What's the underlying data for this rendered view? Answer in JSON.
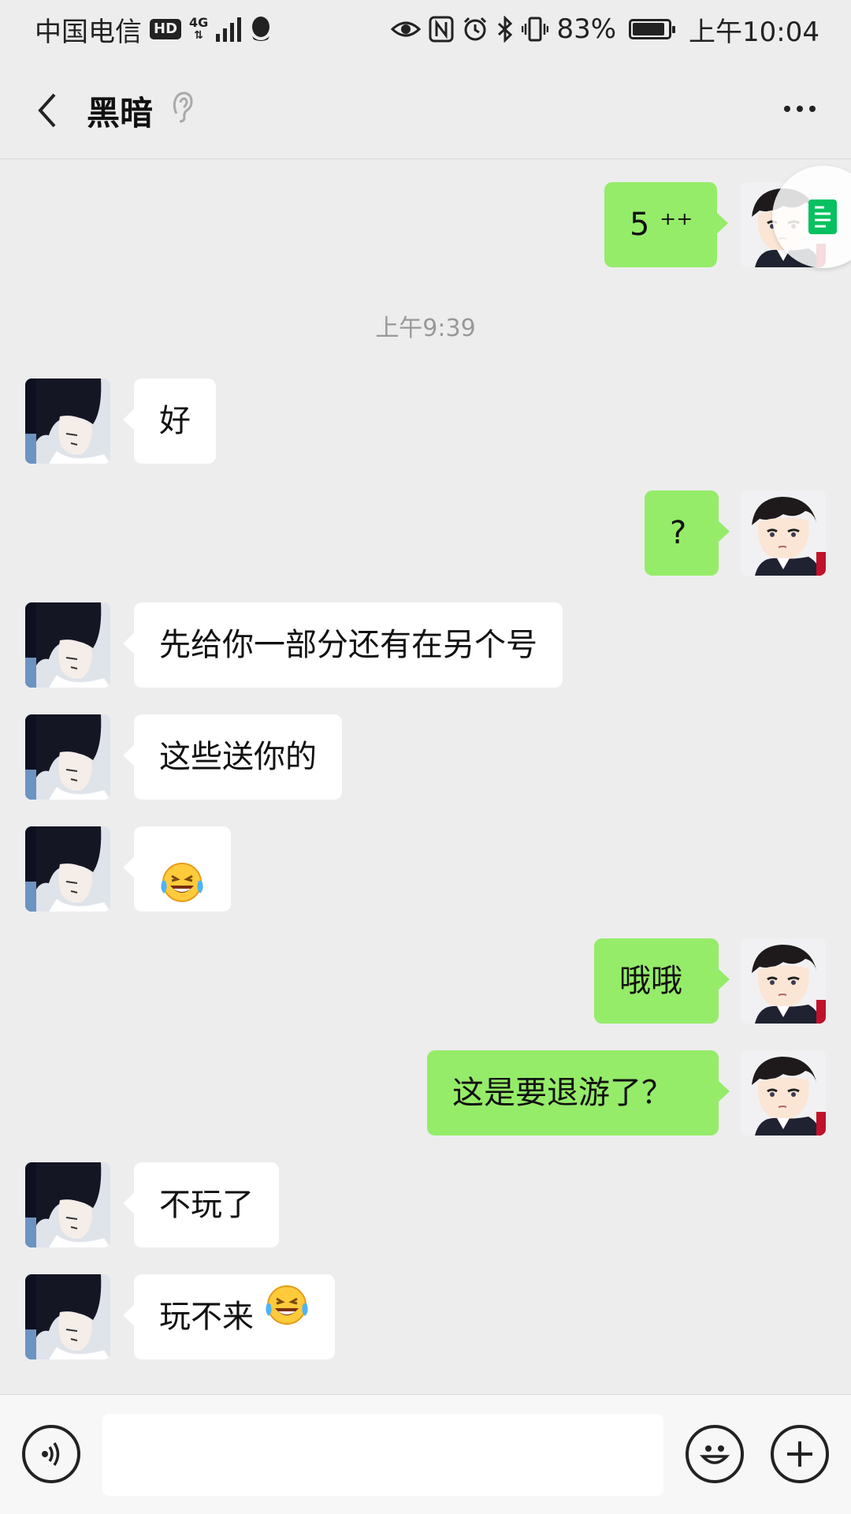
{
  "status_bar": {
    "carrier": "中国电信",
    "hd": "HD",
    "network_top": "4G",
    "network_bottom": "⇅",
    "battery_percent": "83%",
    "battery_level": 0.83,
    "time": "上午10:04",
    "icons": [
      "qq-icon",
      "eye-icon",
      "nfc-icon",
      "alarm-icon",
      "bluetooth-icon",
      "vibrate-icon",
      "battery-icon"
    ]
  },
  "nav": {
    "title": "黑暗",
    "icons": [
      "back-icon",
      "ear-icon",
      "more-icon"
    ]
  },
  "messages": [
    {
      "side": "out",
      "text": "5 ⁺⁺"
    },
    {
      "type": "time",
      "text": "上午9:39"
    },
    {
      "side": "in",
      "text": "好"
    },
    {
      "side": "out",
      "text": "?"
    },
    {
      "side": "in",
      "text": "先给你一部分还有在另个号"
    },
    {
      "side": "in",
      "text": "这些送你的"
    },
    {
      "side": "in",
      "text": "😂"
    },
    {
      "side": "out",
      "text": "哦哦"
    },
    {
      "side": "out",
      "text": "这是要退游了？"
    },
    {
      "side": "in",
      "text": "不玩了"
    },
    {
      "side": "in",
      "text": "玩不来",
      "emoji": "😂"
    }
  ],
  "input_bar": {
    "value": "",
    "icons": [
      "voice-icon",
      "emoji-icon",
      "plus-icon"
    ]
  },
  "colors": {
    "background": "#ededed",
    "bubble_out": "#95ec69",
    "bubble_in": "#ffffff",
    "float_widget": "#07c160"
  }
}
